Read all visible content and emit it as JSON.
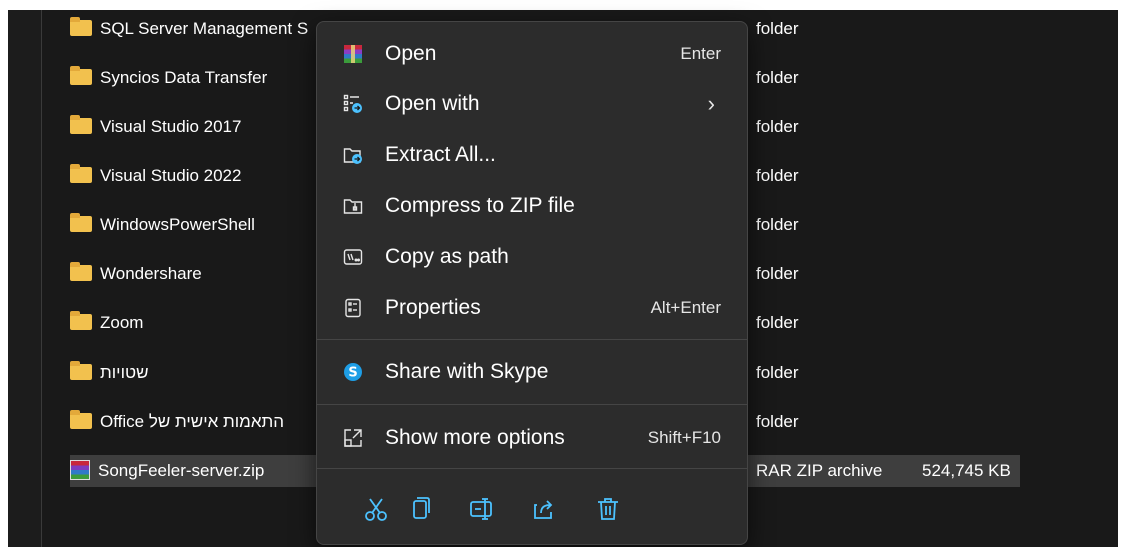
{
  "files": [
    {
      "name": "SQL Server Management S",
      "type": "folder",
      "icon": "folder-icon"
    },
    {
      "name": "Syncios Data Transfer",
      "type": "folder",
      "icon": "folder-icon"
    },
    {
      "name": "Visual Studio 2017",
      "type": "folder",
      "icon": "folder-icon"
    },
    {
      "name": "Visual Studio 2022",
      "type": "folder",
      "icon": "folder-icon"
    },
    {
      "name": "WindowsPowerShell",
      "type": "folder",
      "icon": "folder-icon"
    },
    {
      "name": "Wondershare",
      "type": "folder",
      "icon": "folder-icon"
    },
    {
      "name": "Zoom",
      "type": "folder",
      "icon": "folder-icon"
    },
    {
      "name": "שטויות",
      "type": "folder",
      "icon": "folder-icon"
    },
    {
      "name": "Office התאמות אישית של",
      "type": "folder",
      "icon": "folder-icon"
    },
    {
      "name": "SongFeeler-server.zip",
      "type": "RAR ZIP archive",
      "size": "524,745 KB",
      "icon": "winrar-archive-icon",
      "selected": true
    }
  ],
  "context_menu": {
    "items": [
      {
        "label": "Open",
        "shortcut": "Enter",
        "icon": "winrar-icon"
      },
      {
        "label": "Open with",
        "shortcut": "",
        "icon": "open-with-icon",
        "submenu": true
      },
      {
        "label": "Extract All...",
        "shortcut": "",
        "icon": "extract-folder-icon"
      },
      {
        "label": "Compress to ZIP file",
        "shortcut": "",
        "icon": "zip-folder-icon"
      },
      {
        "label": "Copy as path",
        "shortcut": "",
        "icon": "copy-path-icon"
      },
      {
        "label": "Properties",
        "shortcut": "Alt+Enter",
        "icon": "properties-icon"
      },
      {
        "label": "Share with Skype",
        "shortcut": "",
        "icon": "skype-icon"
      },
      {
        "label": "Show more options",
        "shortcut": "Shift+F10",
        "icon": "show-more-options-icon"
      }
    ],
    "submenu_chevron": "›",
    "toolbar": [
      "cut-icon",
      "copy-icon",
      "rename-icon",
      "share-icon",
      "delete-icon"
    ]
  },
  "colors": {
    "background": "#191919",
    "menu_background": "#2c2c2c",
    "selected_row": "#3e3e3e",
    "accent": "#4cc2ff",
    "folder": "#f2c14e"
  }
}
